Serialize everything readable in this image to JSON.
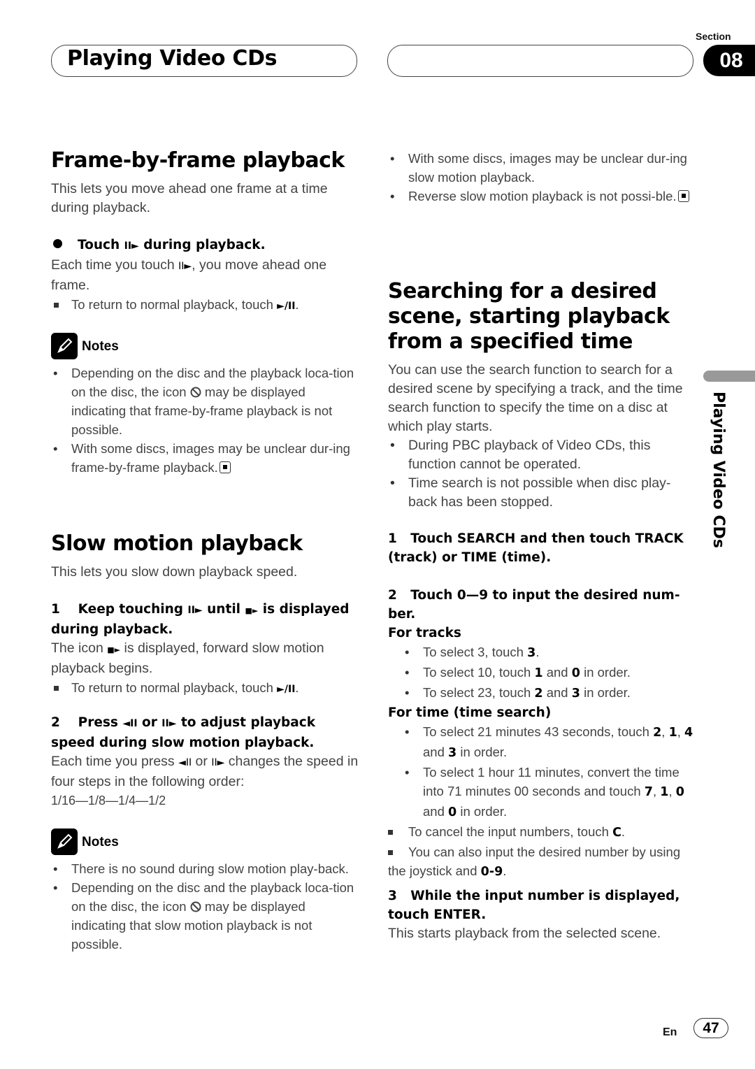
{
  "header": {
    "chapter_title": "Playing Video CDs",
    "section_label": "Section",
    "section_number": "08"
  },
  "sidebar": {
    "label": "Playing Video CDs"
  },
  "footer": {
    "language": "En",
    "page_number": "47"
  },
  "frame_by_frame": {
    "heading": "Frame-by-frame playback",
    "intro": "This lets you move ahead one frame at a time during playback.",
    "step_bullet_pre": "Touch",
    "step_bullet_post": "during playback.",
    "step_desc_pre": "Each time you touch",
    "step_desc_post": ", you move ahead one frame.",
    "return_note_pre": "To return to normal playback, touch",
    "notes_label": "Notes",
    "notes": [
      {
        "pre": "Depending on the disc and the playback loca-tion on the disc, the icon",
        "post": "may be displayed indicating that frame-by-frame playback is not possible."
      },
      {
        "text": "With some discs, images may be unclear dur-ing frame-by-frame playback."
      }
    ]
  },
  "slow_motion": {
    "heading": "Slow motion playback",
    "intro": "This lets you slow down playback speed.",
    "step1_num": "1",
    "step1_a": "Keep touching",
    "step1_b": "until",
    "step1_c": "is displayed during playback.",
    "step1_desc_pre": "The icon",
    "step1_desc_post": "is displayed, forward slow motion playback begins.",
    "return_note_pre": "To return to normal playback, touch",
    "step2_num": "2",
    "step2_a": "Press",
    "step2_b": "or",
    "step2_c": "to adjust playback speed during slow motion playback.",
    "step2_desc_a": "Each time you press",
    "step2_desc_b": "or",
    "step2_desc_c": "changes the speed in four steps in the following order:",
    "speed_order": "1/16—1/8—1/4—1/2",
    "notes_label": "Notes",
    "notes": [
      {
        "text": "There is no sound during slow motion play-back."
      },
      {
        "pre": "Depending on the disc and the playback loca-tion on the disc, the icon",
        "post": "may be displayed indicating that slow motion playback is not possible."
      }
    ],
    "notes_continued": [
      "With some discs, images may be unclear dur-ing slow motion playback.",
      "Reverse slow motion playback is not possi-ble."
    ]
  },
  "search": {
    "heading_lines": [
      "Searching for a desired",
      "scene, starting playback",
      "from a specified time"
    ],
    "intro": "You can use the search function to search for a desired scene by specifying a track, and the time search function to specify the time on a disc at which play starts.",
    "bullets": [
      "During PBC playback of Video CDs, this function cannot be operated.",
      "Time search is not possible when disc play-back has been stopped."
    ],
    "step1_num": "1",
    "step1": "Touch SEARCH and then touch TRACK (track) or TIME (time).",
    "step2_num": "2",
    "step2": "Touch 0—9 to input the desired num-ber.",
    "for_tracks": "For tracks",
    "tracks": [
      {
        "a": "To select 3, touch ",
        "b1": "3",
        "c": "."
      },
      {
        "a": "To select 10, touch ",
        "b1": "1",
        "m": " and ",
        "b2": "0",
        "c": " in order."
      },
      {
        "a": "To select 23, touch ",
        "b1": "2",
        "m": " and ",
        "b2": "3",
        "c": " in order."
      }
    ],
    "for_time": "For time (time search)",
    "time1": {
      "a": "To select 21 minutes 43 seconds, touch ",
      "b1": "2",
      "s1": ", ",
      "b2": "1",
      "s2": ", ",
      "b3": "4",
      "s3": " and ",
      "b4": "3",
      "c": " in order."
    },
    "time2": {
      "a": "To select 1 hour 11 minutes, convert the time into 71 minutes 00 seconds and touch ",
      "b1": "7",
      "s1": ", ",
      "b2": "1",
      "s2": ", ",
      "b3": "0",
      "s3": " and ",
      "b4": "0",
      "c": " in order."
    },
    "cancel": {
      "a": "To cancel the input numbers, touch ",
      "b": "C",
      "c": "."
    },
    "joystick": {
      "a": "You can also input the desired number by using the joystick and ",
      "b": "0-9",
      "c": "."
    },
    "step3_num": "3",
    "step3": "While the input number is displayed, touch ENTER.",
    "step3_desc": "This starts playback from the selected scene."
  },
  "icons": {
    "frame_advance": "II►",
    "frame_reverse": "◄II",
    "play_pause": "►/II",
    "slow_forward": "■►"
  }
}
